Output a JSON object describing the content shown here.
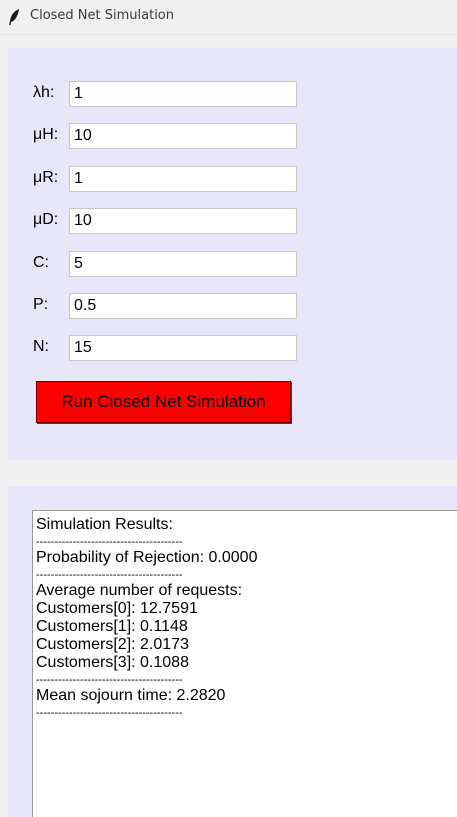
{
  "window": {
    "title": "Closed Net Simulation",
    "icon": "feather-icon"
  },
  "params": [
    {
      "label": "λh:",
      "value": "1"
    },
    {
      "label": "μH:",
      "value": "10"
    },
    {
      "label": "μR:",
      "value": "1"
    },
    {
      "label": "μD:",
      "value": "10"
    },
    {
      "label": "C:",
      "value": "5"
    },
    {
      "label": "P:",
      "value": "0.5"
    },
    {
      "label": "N:",
      "value": "15"
    }
  ],
  "run_button": {
    "label": "Run  Closed Net Simulation",
    "color": "#ff0000"
  },
  "results": {
    "heading": "Simulation Results:",
    "separator": "----------------------------------------",
    "rejection": "Probability of Rejection: 0.0000",
    "avg_heading": "Average number of requests:",
    "customers": [
      "Customers[0]: 12.7591",
      "Customers[1]: 0.1148",
      "Customers[2]: 2.0173",
      "Customers[3]: 0.1088"
    ],
    "sojourn": "Mean sojourn time: 2.2820"
  },
  "colors": {
    "panel_background": "#e6e6f8",
    "window_background": "#f0f0f0"
  }
}
